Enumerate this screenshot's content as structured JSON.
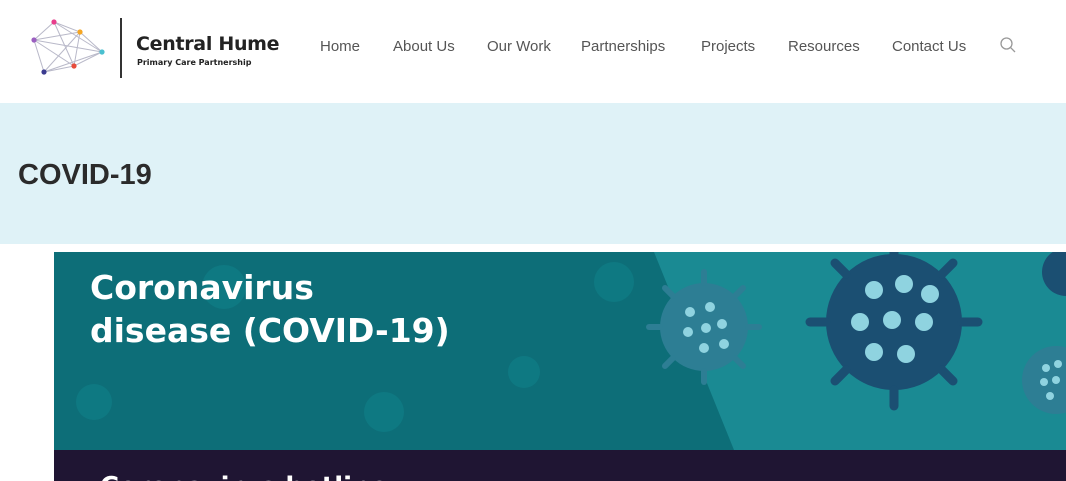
{
  "header": {
    "logo": {
      "name": "Central Hume",
      "subtitle": "Primary Care Partnership",
      "icon": "network-triangle-logo"
    },
    "nav": [
      "Home",
      "About Us",
      "Our Work",
      "Partnerships",
      "Projects",
      "Resources",
      "Contact Us"
    ],
    "search_icon": "search-icon"
  },
  "page": {
    "title": "COVID-19"
  },
  "banner": {
    "line1": "Coronavirus",
    "line2": "disease (COVID-19)",
    "hotline": "Coronavirus hotline",
    "colors": {
      "background": "#0d6e78",
      "virus": "#1b4f72",
      "hotline_bar": "#1f1533"
    }
  }
}
